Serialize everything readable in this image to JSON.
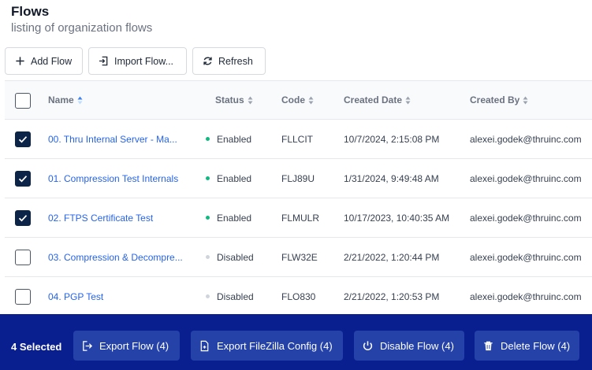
{
  "header": {
    "title": "Flows",
    "subtitle": "listing of organization flows"
  },
  "toolbar": {
    "add_label": "Add Flow",
    "import_label": "Import Flow...",
    "refresh_label": "Refresh"
  },
  "table": {
    "columns": {
      "name": "Name",
      "status": "Status",
      "code": "Code",
      "created_date": "Created Date",
      "created_by": "Created By"
    },
    "rows": [
      {
        "checked": true,
        "name": "00. Thru Internal Server - Ma...",
        "status": "Enabled",
        "code": "FLLCIT",
        "created_date": "10/7/2024, 2:15:08 PM",
        "created_by": "alexei.godek@thruinc.com"
      },
      {
        "checked": true,
        "name": "01. Compression Test Internals",
        "status": "Enabled",
        "code": "FLJ89U",
        "created_date": "1/31/2024, 9:49:48 AM",
        "created_by": "alexei.godek@thruinc.com"
      },
      {
        "checked": true,
        "name": "02. FTPS Certificate Test",
        "status": "Enabled",
        "code": "FLMULR",
        "created_date": "10/17/2023, 10:40:35 AM",
        "created_by": "alexei.godek@thruinc.com"
      },
      {
        "checked": false,
        "name": "03. Compression & Decompre...",
        "status": "Disabled",
        "code": "FLW32E",
        "created_date": "2/21/2022, 1:20:44 PM",
        "created_by": "alexei.godek@thruinc.com"
      },
      {
        "checked": false,
        "name": "04. PGP Test",
        "status": "Disabled",
        "code": "FLO830",
        "created_date": "2/21/2022, 1:20:53 PM",
        "created_by": "alexei.godek@thruinc.com"
      }
    ]
  },
  "bulk_actions": {
    "selected_label": "4 Selected",
    "export_flow": "Export Flow (4)",
    "export_filezilla": "Export FileZilla Config (4)",
    "disable_flow": "Disable Flow (4)",
    "delete_flow": "Delete Flow (4)"
  },
  "colors": {
    "link": "#2563eb",
    "enabled_dot": "#10b981",
    "disabled_dot": "#d1d5db",
    "checkbox_checked": "#0b2447",
    "bulk_bar": "#0a1f8f",
    "bulk_button": "#2442a8"
  },
  "icons": {
    "add": "plus-icon",
    "import": "import-icon",
    "refresh": "refresh-icon",
    "sort": "sort-icon",
    "export": "export-icon",
    "filezilla": "file-icon",
    "disable": "power-icon",
    "delete": "trash-icon"
  }
}
